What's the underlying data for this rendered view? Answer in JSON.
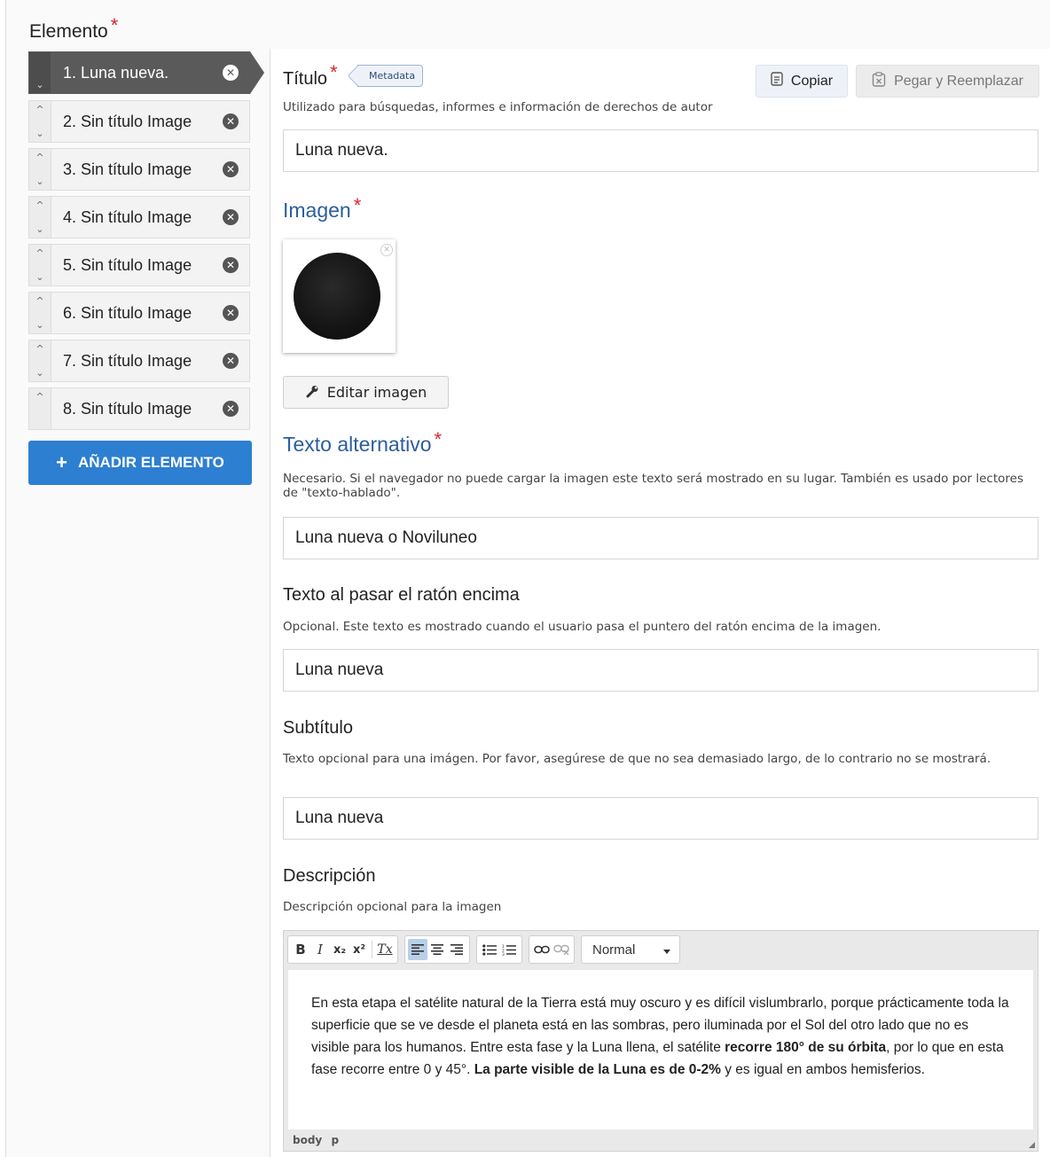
{
  "section": {
    "title": "Elemento",
    "required_mark": "*"
  },
  "sidebar": {
    "items": [
      {
        "label": "1. Luna nueva.",
        "active": true
      },
      {
        "label": "2. Sin título Image",
        "active": false
      },
      {
        "label": "3. Sin título Image",
        "active": false
      },
      {
        "label": "4. Sin título Image",
        "active": false
      },
      {
        "label": "5. Sin título Image",
        "active": false
      },
      {
        "label": "6. Sin título Image",
        "active": false
      },
      {
        "label": "7. Sin título Image",
        "active": false
      },
      {
        "label": "8. Sin título Image",
        "active": false
      }
    ],
    "up_glyph": "^",
    "down_glyph": "⌄",
    "remove_glyph": "✕",
    "add_button": {
      "icon": "+",
      "label": "AÑADIR ELEMENTO"
    }
  },
  "title_field": {
    "label": "Título",
    "metadata_tag": "Metadata",
    "copy_label": "Copiar",
    "paste_label": "Pegar y Reemplazar",
    "description": "Utilizado para búsquedas, informes e información de derechos de autor",
    "value": "Luna nueva."
  },
  "image_field": {
    "label": "Imagen",
    "edit_button": "Editar imagen"
  },
  "alt_field": {
    "label": "Texto alternativo",
    "description": "Necesario. Si el navegador no puede cargar la imagen este texto será mostrado en su lugar. También es usado por lectores de \"texto-hablado\".",
    "value": "Luna nueva o Noviluneo"
  },
  "hover_field": {
    "label": "Texto al pasar el ratón encima",
    "description": "Opcional. Este texto es mostrado cuando el usuario pasa el puntero del ratón encima de la imagen.",
    "value": "Luna nueva"
  },
  "subtitle_field": {
    "label": "Subtítulo",
    "description": "Texto opcional para una imágen. Por favor, asegúrese de que no sea demasiado largo, de lo contrario no se mostrará.",
    "value": "Luna nueva"
  },
  "description_field": {
    "label": "Descripción",
    "description": "Descripción opcional para la imagen",
    "format_value": "Normal",
    "body": {
      "part1": "En esta etapa el satélite natural de la Tierra está muy oscuro y es difícil vislumbrarlo, porque prácticamente toda la superficie que se ve desde el planeta está en las sombras, pero iluminada por el Sol del otro lado que no es visible para los humanos. Entre esta fase y la Luna llena, el satélite ",
      "bold1": "recorre 180° de su órbita",
      "part2": ", por lo que en esta fase recorre entre 0 y 45°. ",
      "bold2": "La parte visible de la Luna es de 0-2%",
      "part3": " y es igual en ambos hemisferios."
    },
    "path": [
      "body",
      "p"
    ]
  },
  "toolbar": {
    "bold": "B",
    "italic": "I",
    "subscript": "x₂",
    "superscript": "x²",
    "clear": "Tx"
  }
}
